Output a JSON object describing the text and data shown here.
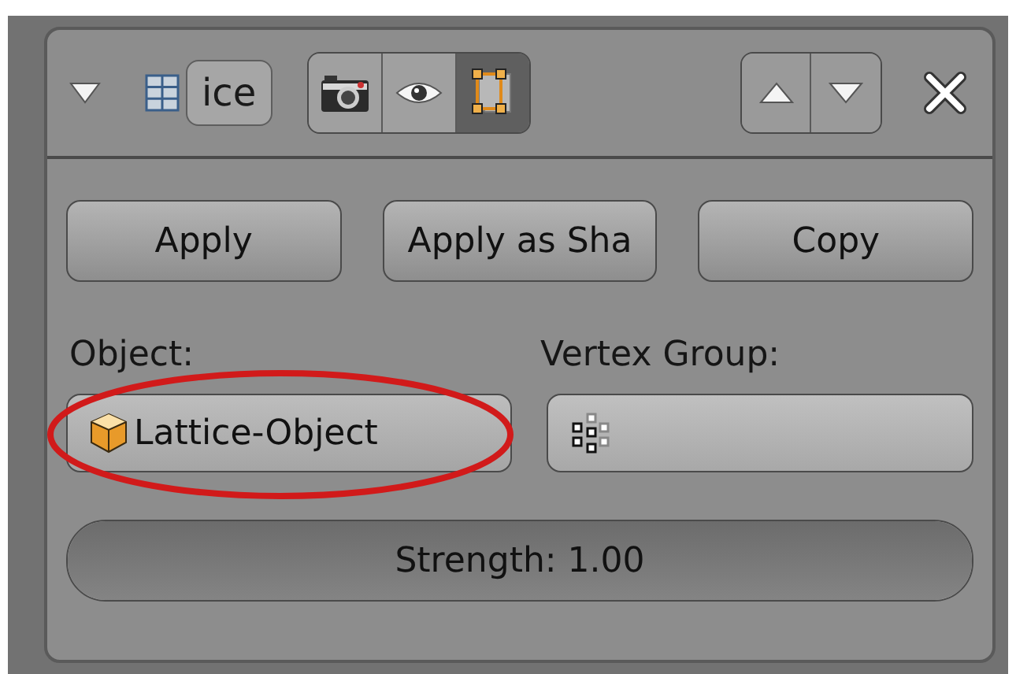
{
  "header": {
    "expanded": true,
    "name": "ice",
    "toggles": [
      {
        "kind": "render",
        "on": false
      },
      {
        "kind": "viewport",
        "on": false
      },
      {
        "kind": "editmode",
        "on": true
      }
    ]
  },
  "buttons": [
    "Apply",
    "Apply as Sha",
    "Copy"
  ],
  "object": {
    "label": "Object:",
    "value": "Lattice-Object",
    "circled": true
  },
  "vertex_group": {
    "label": "Vertex Group:"
  },
  "strength": {
    "text": "Strength: 1.00",
    "level": 1
  }
}
